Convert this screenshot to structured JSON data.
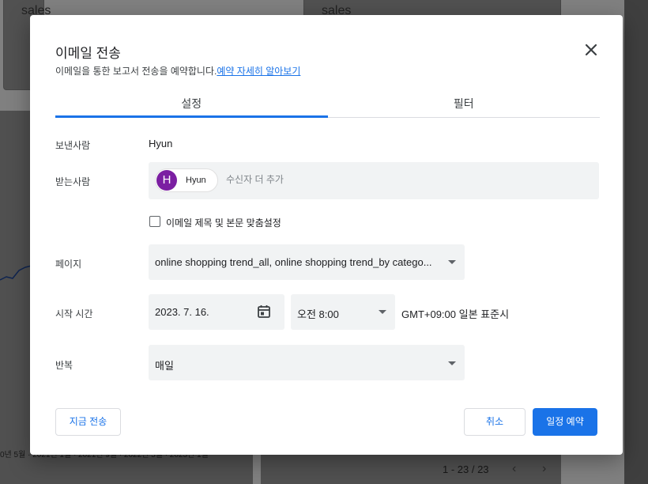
{
  "background": {
    "card1_title": "sales",
    "card2_title": "sales",
    "pager_text": "1 - 23 / 23",
    "pager_prev": "‹",
    "pager_next": "›",
    "axis_text": "0년 5월 · 2021년 1월 · 2021년 9월 · 2022년 5월 · 2023년 1월"
  },
  "dialog": {
    "title": "이메일 전송",
    "subtitle": "이메일을 통한 보고서 전송을 예약합니다.",
    "learn_more_link": "예약 자세히 알아보기",
    "close_icon": "close-icon",
    "tabs": [
      {
        "label": "설정",
        "active": true
      },
      {
        "label": "필터",
        "active": false
      }
    ],
    "sender": {
      "label": "보낸사람",
      "value": "Hyun"
    },
    "recipients": {
      "label": "받는사람",
      "chips": [
        {
          "initial": "H",
          "name": "Hyun",
          "avatar_color": "#7b1fa2"
        }
      ],
      "placeholder": "수신자 더 추가"
    },
    "customize_checkbox": {
      "label": "이메일 제목 및 본문 맞춤설정",
      "checked": false
    },
    "pages": {
      "label": "페이지",
      "value": "online shopping trend_all, online shopping trend_by catego..."
    },
    "start_time": {
      "label": "시작 시간",
      "date": "2023. 7. 16.",
      "calendar_icon": "calendar-icon",
      "time": "오전 8:00",
      "timezone": "GMT+09:00 일본 표준시"
    },
    "repeat": {
      "label": "반복",
      "value": "매일"
    },
    "buttons": {
      "send_now": "지금 전송",
      "cancel": "취소",
      "schedule": "일정 예약"
    }
  },
  "colors": {
    "accent": "#1a73e8",
    "field_bg": "#f1f3f4",
    "avatar": "#7b1fa2"
  }
}
